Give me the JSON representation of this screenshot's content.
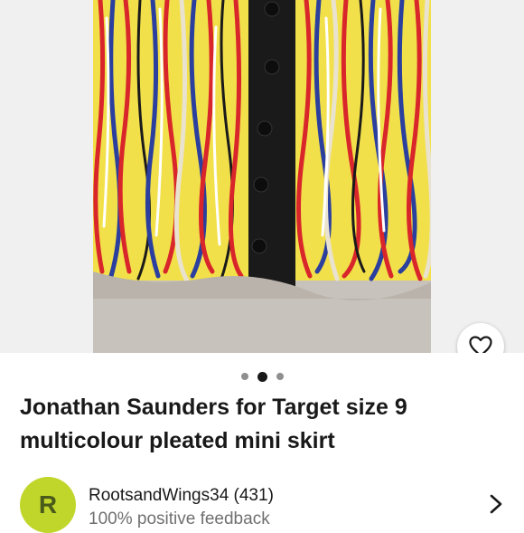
{
  "listing": {
    "title_line1": "Jonathan Saunders for Target size 9",
    "title_line2": "multicolour pleated mini skirt",
    "photo_icon": "product-photo",
    "favorite_icon": "heart-outline-icon"
  },
  "gallery": {
    "image_count": 3,
    "active_index": 1
  },
  "seller": {
    "avatar_letter": "R",
    "name_with_count": "RootsandWings34 (431)",
    "feedback": "100% positive feedback",
    "chevron_icon": "chevron-right-icon"
  },
  "colors": {
    "avatar_bg": "#c1d62b",
    "text_primary": "#191919",
    "text_secondary": "#707070"
  }
}
